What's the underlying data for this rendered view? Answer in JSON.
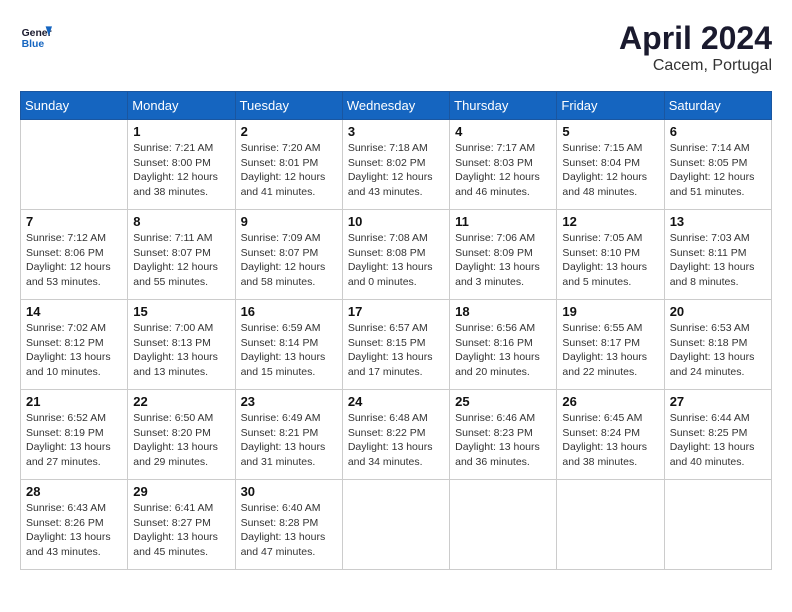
{
  "header": {
    "logo_line1": "General",
    "logo_line2": "Blue",
    "month_year": "April 2024",
    "location": "Cacem, Portugal"
  },
  "weekdays": [
    "Sunday",
    "Monday",
    "Tuesday",
    "Wednesday",
    "Thursday",
    "Friday",
    "Saturday"
  ],
  "weeks": [
    [
      {
        "day": "",
        "sunrise": "",
        "sunset": "",
        "daylight": ""
      },
      {
        "day": "1",
        "sunrise": "Sunrise: 7:21 AM",
        "sunset": "Sunset: 8:00 PM",
        "daylight": "Daylight: 12 hours and 38 minutes."
      },
      {
        "day": "2",
        "sunrise": "Sunrise: 7:20 AM",
        "sunset": "Sunset: 8:01 PM",
        "daylight": "Daylight: 12 hours and 41 minutes."
      },
      {
        "day": "3",
        "sunrise": "Sunrise: 7:18 AM",
        "sunset": "Sunset: 8:02 PM",
        "daylight": "Daylight: 12 hours and 43 minutes."
      },
      {
        "day": "4",
        "sunrise": "Sunrise: 7:17 AM",
        "sunset": "Sunset: 8:03 PM",
        "daylight": "Daylight: 12 hours and 46 minutes."
      },
      {
        "day": "5",
        "sunrise": "Sunrise: 7:15 AM",
        "sunset": "Sunset: 8:04 PM",
        "daylight": "Daylight: 12 hours and 48 minutes."
      },
      {
        "day": "6",
        "sunrise": "Sunrise: 7:14 AM",
        "sunset": "Sunset: 8:05 PM",
        "daylight": "Daylight: 12 hours and 51 minutes."
      }
    ],
    [
      {
        "day": "7",
        "sunrise": "Sunrise: 7:12 AM",
        "sunset": "Sunset: 8:06 PM",
        "daylight": "Daylight: 12 hours and 53 minutes."
      },
      {
        "day": "8",
        "sunrise": "Sunrise: 7:11 AM",
        "sunset": "Sunset: 8:07 PM",
        "daylight": "Daylight: 12 hours and 55 minutes."
      },
      {
        "day": "9",
        "sunrise": "Sunrise: 7:09 AM",
        "sunset": "Sunset: 8:07 PM",
        "daylight": "Daylight: 12 hours and 58 minutes."
      },
      {
        "day": "10",
        "sunrise": "Sunrise: 7:08 AM",
        "sunset": "Sunset: 8:08 PM",
        "daylight": "Daylight: 13 hours and 0 minutes."
      },
      {
        "day": "11",
        "sunrise": "Sunrise: 7:06 AM",
        "sunset": "Sunset: 8:09 PM",
        "daylight": "Daylight: 13 hours and 3 minutes."
      },
      {
        "day": "12",
        "sunrise": "Sunrise: 7:05 AM",
        "sunset": "Sunset: 8:10 PM",
        "daylight": "Daylight: 13 hours and 5 minutes."
      },
      {
        "day": "13",
        "sunrise": "Sunrise: 7:03 AM",
        "sunset": "Sunset: 8:11 PM",
        "daylight": "Daylight: 13 hours and 8 minutes."
      }
    ],
    [
      {
        "day": "14",
        "sunrise": "Sunrise: 7:02 AM",
        "sunset": "Sunset: 8:12 PM",
        "daylight": "Daylight: 13 hours and 10 minutes."
      },
      {
        "day": "15",
        "sunrise": "Sunrise: 7:00 AM",
        "sunset": "Sunset: 8:13 PM",
        "daylight": "Daylight: 13 hours and 13 minutes."
      },
      {
        "day": "16",
        "sunrise": "Sunrise: 6:59 AM",
        "sunset": "Sunset: 8:14 PM",
        "daylight": "Daylight: 13 hours and 15 minutes."
      },
      {
        "day": "17",
        "sunrise": "Sunrise: 6:57 AM",
        "sunset": "Sunset: 8:15 PM",
        "daylight": "Daylight: 13 hours and 17 minutes."
      },
      {
        "day": "18",
        "sunrise": "Sunrise: 6:56 AM",
        "sunset": "Sunset: 8:16 PM",
        "daylight": "Daylight: 13 hours and 20 minutes."
      },
      {
        "day": "19",
        "sunrise": "Sunrise: 6:55 AM",
        "sunset": "Sunset: 8:17 PM",
        "daylight": "Daylight: 13 hours and 22 minutes."
      },
      {
        "day": "20",
        "sunrise": "Sunrise: 6:53 AM",
        "sunset": "Sunset: 8:18 PM",
        "daylight": "Daylight: 13 hours and 24 minutes."
      }
    ],
    [
      {
        "day": "21",
        "sunrise": "Sunrise: 6:52 AM",
        "sunset": "Sunset: 8:19 PM",
        "daylight": "Daylight: 13 hours and 27 minutes."
      },
      {
        "day": "22",
        "sunrise": "Sunrise: 6:50 AM",
        "sunset": "Sunset: 8:20 PM",
        "daylight": "Daylight: 13 hours and 29 minutes."
      },
      {
        "day": "23",
        "sunrise": "Sunrise: 6:49 AM",
        "sunset": "Sunset: 8:21 PM",
        "daylight": "Daylight: 13 hours and 31 minutes."
      },
      {
        "day": "24",
        "sunrise": "Sunrise: 6:48 AM",
        "sunset": "Sunset: 8:22 PM",
        "daylight": "Daylight: 13 hours and 34 minutes."
      },
      {
        "day": "25",
        "sunrise": "Sunrise: 6:46 AM",
        "sunset": "Sunset: 8:23 PM",
        "daylight": "Daylight: 13 hours and 36 minutes."
      },
      {
        "day": "26",
        "sunrise": "Sunrise: 6:45 AM",
        "sunset": "Sunset: 8:24 PM",
        "daylight": "Daylight: 13 hours and 38 minutes."
      },
      {
        "day": "27",
        "sunrise": "Sunrise: 6:44 AM",
        "sunset": "Sunset: 8:25 PM",
        "daylight": "Daylight: 13 hours and 40 minutes."
      }
    ],
    [
      {
        "day": "28",
        "sunrise": "Sunrise: 6:43 AM",
        "sunset": "Sunset: 8:26 PM",
        "daylight": "Daylight: 13 hours and 43 minutes."
      },
      {
        "day": "29",
        "sunrise": "Sunrise: 6:41 AM",
        "sunset": "Sunset: 8:27 PM",
        "daylight": "Daylight: 13 hours and 45 minutes."
      },
      {
        "day": "30",
        "sunrise": "Sunrise: 6:40 AM",
        "sunset": "Sunset: 8:28 PM",
        "daylight": "Daylight: 13 hours and 47 minutes."
      },
      {
        "day": "",
        "sunrise": "",
        "sunset": "",
        "daylight": ""
      },
      {
        "day": "",
        "sunrise": "",
        "sunset": "",
        "daylight": ""
      },
      {
        "day": "",
        "sunrise": "",
        "sunset": "",
        "daylight": ""
      },
      {
        "day": "",
        "sunrise": "",
        "sunset": "",
        "daylight": ""
      }
    ]
  ]
}
